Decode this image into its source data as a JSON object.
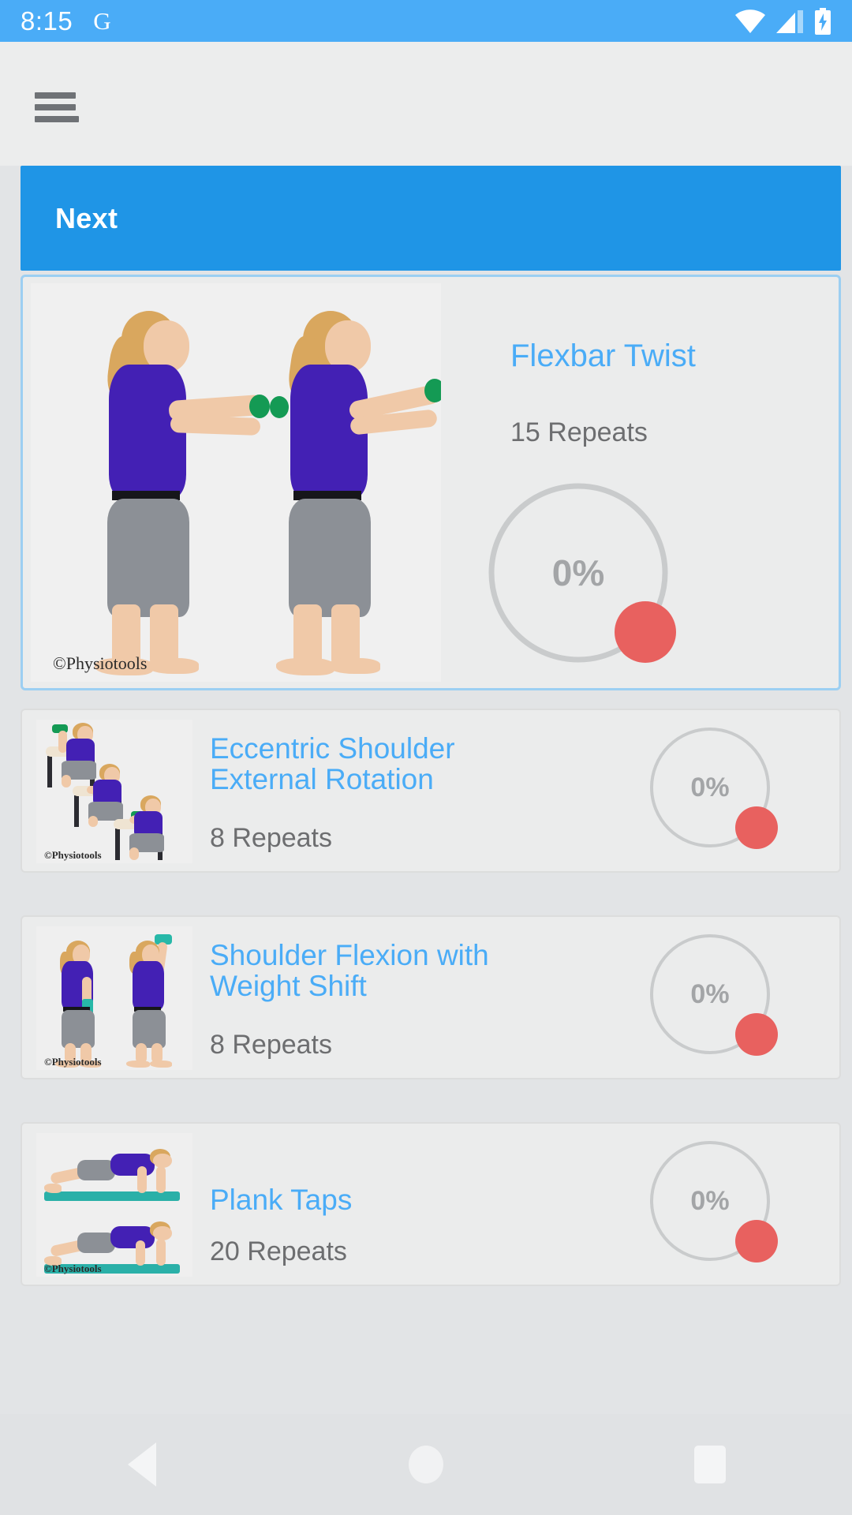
{
  "status_bar": {
    "time": "8:15",
    "app_badge": "G",
    "icons": [
      "wifi-icon",
      "cellular-signal-icon",
      "battery-charging-icon"
    ]
  },
  "app_bar": {
    "menu_icon": "hamburger-menu-icon"
  },
  "next_button": {
    "label": "Next"
  },
  "featured_exercise": {
    "title": "Flexbar Twist",
    "repeats": "15 Repeats",
    "progress_text": "0%",
    "progress_value": 0,
    "watermark": "©Physiotools",
    "image_alt": "two-figures-flexbar-twist"
  },
  "exercise_list": [
    {
      "title": "Eccentric Shoulder External Rotation",
      "repeats": "8 Repeats",
      "progress_text": "0%",
      "progress_value": 0,
      "watermark": "©Physiotools",
      "image_alt": "three-seated-figures-external-rotation"
    },
    {
      "title": "Shoulder Flexion with Weight Shift",
      "repeats": "8 Repeats",
      "progress_text": "0%",
      "progress_value": 0,
      "watermark": "©Physiotools",
      "image_alt": "two-standing-figures-shoulder-flexion"
    },
    {
      "title": "Plank Taps",
      "repeats": "20 Repeats",
      "progress_text": "0%",
      "progress_value": 0,
      "watermark": "©Physiotools",
      "image_alt": "two-plank-figures-on-mat"
    }
  ],
  "nav_bar": {
    "back": "back-nav-button",
    "home": "home-nav-button",
    "recents": "recents-nav-button"
  },
  "colors": {
    "status_bar": "#4aacf7",
    "accent_blue": "#1f95e6",
    "title_blue": "#4aacf7",
    "progress_dot_red": "#e8615f",
    "ring_gray": "#c9cbcc",
    "page_bg": "#e2e4e6",
    "card_bg": "#ebecec"
  }
}
